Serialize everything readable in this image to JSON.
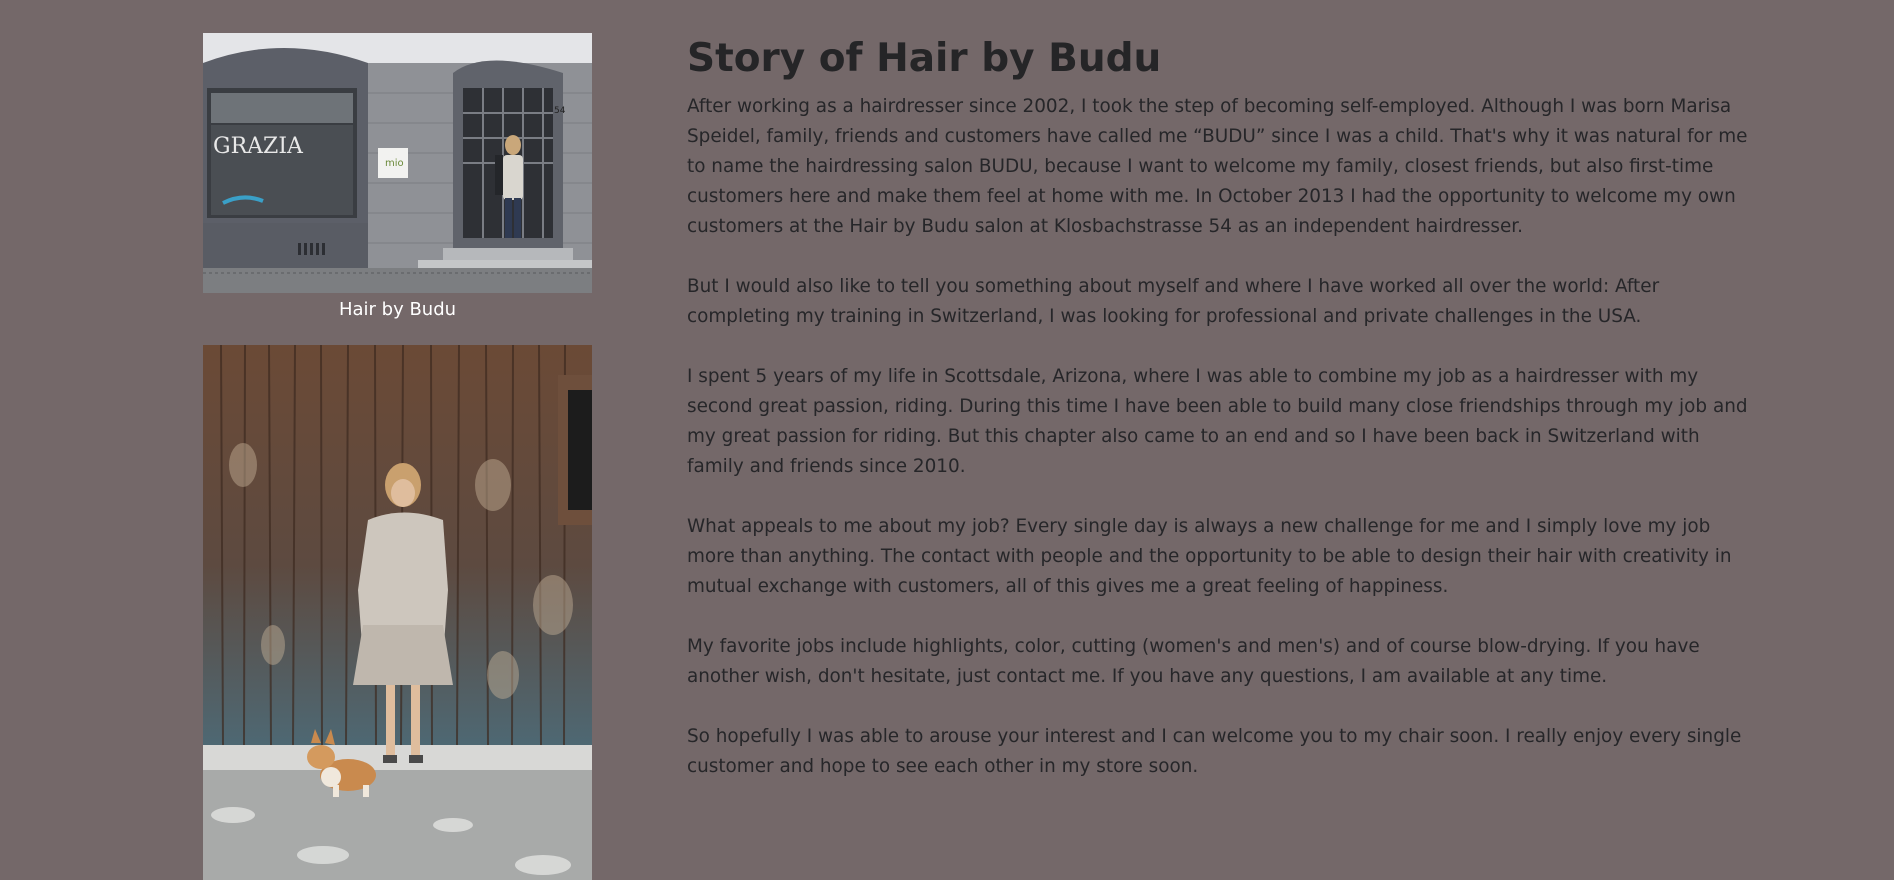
{
  "gallery": {
    "salon_caption": "Hair by Budu"
  },
  "story": {
    "title": "Story of Hair by Budu",
    "paragraphs": [
      "After working as a hairdresser since 2002, I took the step of becoming self-employed. Although I was born Marisa Speidel, family, friends and customers have called me “BUDU” since I was a child. That's why it was natural for me to name the hairdressing salon BUDU, because I want to welcome my family, closest friends, but also first-time customers here and make them feel at home with me. In October 2013 I had the opportunity to welcome my own customers at the Hair by Budu salon at Klosbachstrasse 54 as an independent hairdresser.",
      "But I would also like to tell you something about myself and where I have worked all over the world: After completing my training in Switzerland, I was looking for professional and private challenges in the USA.",
      "I spent 5 years of my life in Scottsdale, Arizona, where I was able to combine my job as a hairdresser with my second great passion, riding. During this time I have been able to build many close friendships through my job and my great passion for riding. But this chapter also came to an end and so I have been back in Switzerland with family and friends since 2010.",
      "What appeals to me about my job? Every single day is always a new challenge for me and I simply love my job more than anything. The contact with people and the opportunity to be able to design their hair with creativity in mutual exchange with customers, all of this gives me a great feeling of happiness.",
      "My favorite jobs include highlights, color, cutting (women's and men's) and of course blow-drying. If you have another wish, don't hesitate, just contact me. If you have any questions, I am available at any time.",
      "So hopefully I was able to arouse your interest and I can welcome you to my chair soon. I really enjoy every single customer and hope to see each other in my store soon."
    ]
  },
  "photo_signage": {
    "window_text": "GRAZIA",
    "door_number": "54",
    "plaque": "mio"
  },
  "colors": {
    "background": "#746869",
    "text": "#262629",
    "caption": "#ffffff"
  }
}
